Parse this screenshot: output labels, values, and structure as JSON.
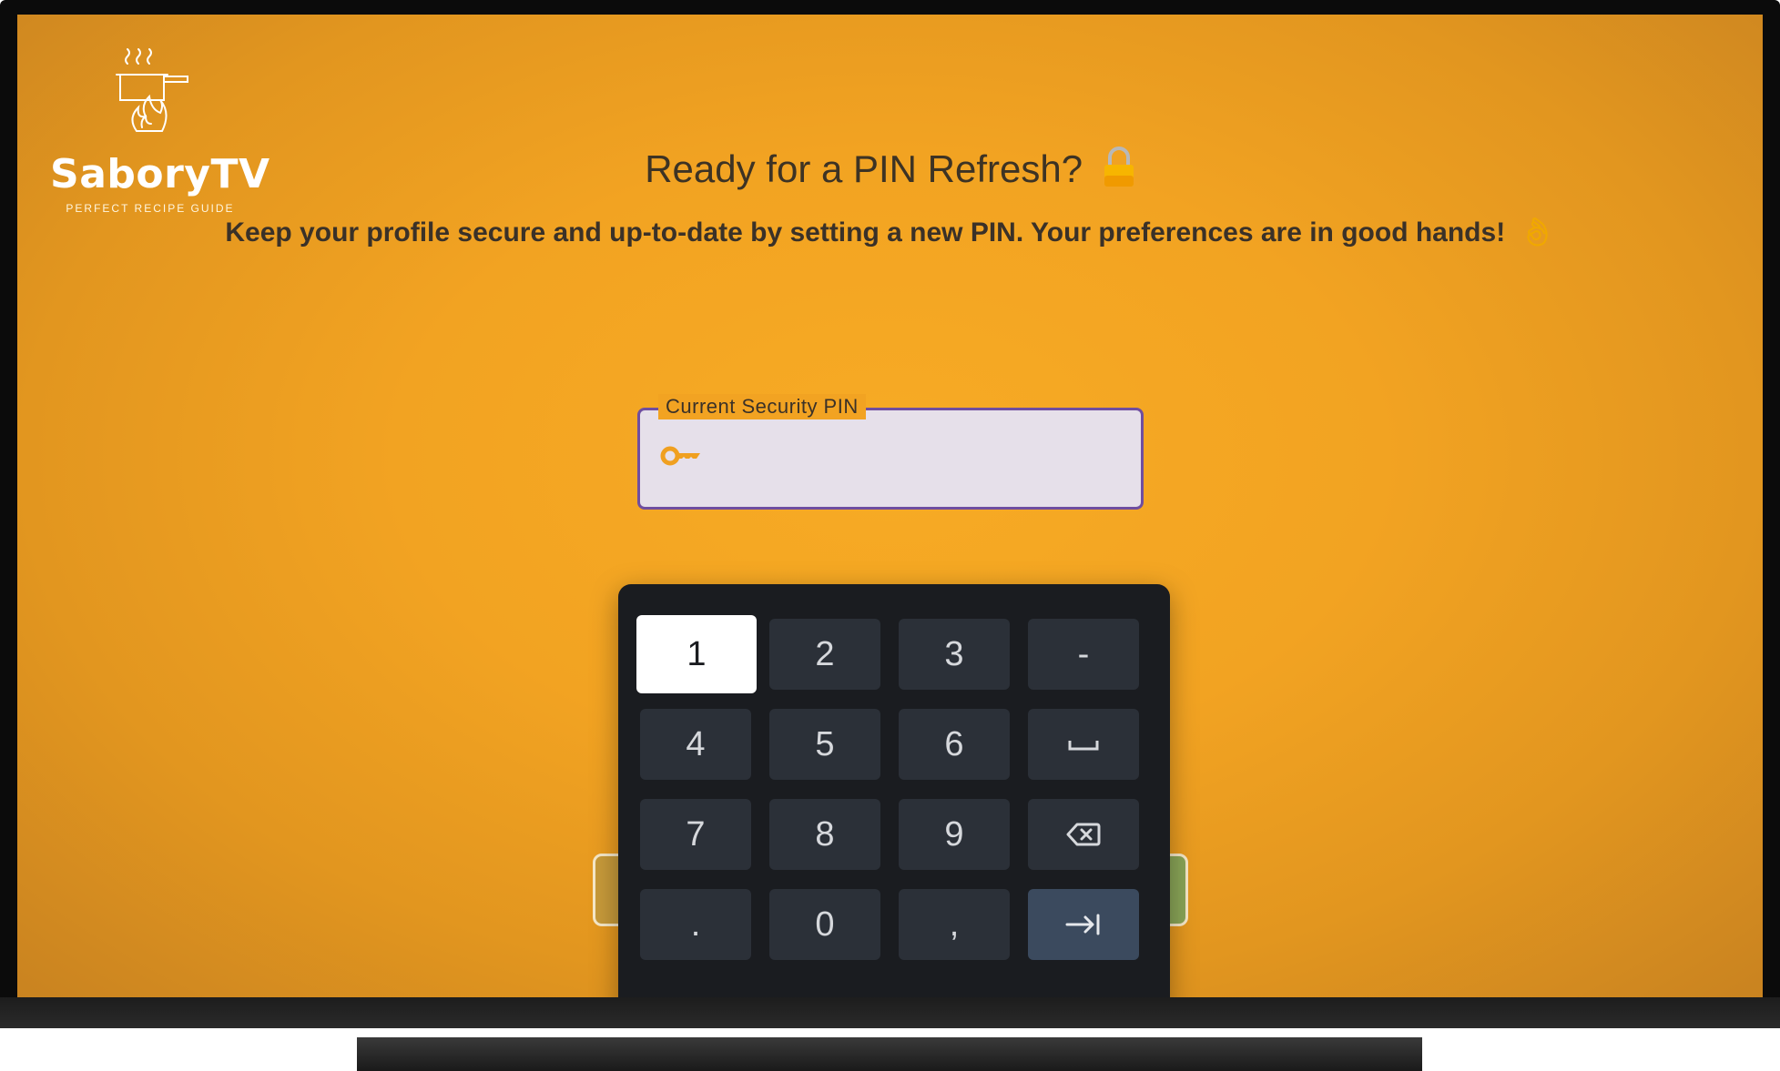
{
  "app": {
    "name": "SaboryTV",
    "tagline": "PERFECT RECIPE GUIDE"
  },
  "header": {
    "title": "Ready for a PIN Refresh?",
    "title_icon": "lock-icon",
    "subtitle": "Keep your profile secure and up-to-date by setting a new PIN. Your preferences are in good hands!",
    "subtitle_icon": "ok-hand-icon"
  },
  "pin_field": {
    "label": "Current Security PIN",
    "value": "",
    "icon": "key-icon"
  },
  "keypad": {
    "rows": [
      [
        {
          "label": "1",
          "name": "key-1",
          "focused": true
        },
        {
          "label": "2",
          "name": "key-2"
        },
        {
          "label": "3",
          "name": "key-3"
        },
        {
          "label": "-",
          "name": "key-minus"
        }
      ],
      [
        {
          "label": "4",
          "name": "key-4"
        },
        {
          "label": "5",
          "name": "key-5"
        },
        {
          "label": "6",
          "name": "key-6"
        },
        {
          "label": "",
          "name": "space-key",
          "icon": "space-icon"
        }
      ],
      [
        {
          "label": "7",
          "name": "key-7"
        },
        {
          "label": "8",
          "name": "key-8"
        },
        {
          "label": "9",
          "name": "key-9"
        },
        {
          "label": "",
          "name": "backspace-key",
          "icon": "backspace-icon"
        }
      ],
      [
        {
          "label": ".",
          "name": "key-period"
        },
        {
          "label": "0",
          "name": "key-0"
        },
        {
          "label": ",",
          "name": "key-comma"
        },
        {
          "label": "",
          "name": "next-key",
          "icon": "tab-next-icon"
        }
      ]
    ]
  },
  "colors": {
    "background": "#f2a322",
    "field_border": "#6f4ea0",
    "field_fill": "#e6e0ea",
    "keypad_bg": "#1a1c20",
    "key_bg": "#2b3038",
    "key_action_bg": "#3b4a5e"
  }
}
